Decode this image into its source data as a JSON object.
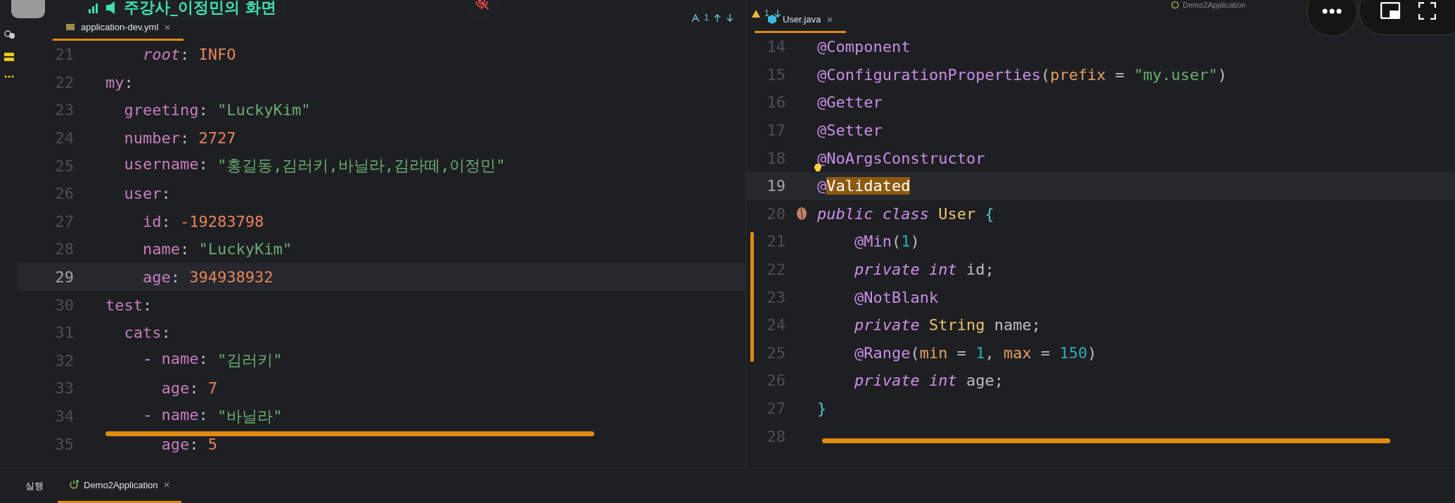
{
  "share_overlay": {
    "presenter_label": "주강사_이정민의 화면",
    "mic_muted": true
  },
  "run_config": {
    "label": "Demo2Application"
  },
  "editors": [
    {
      "tab": {
        "label": "application-dev.yml",
        "selected": true
      },
      "inspection": "1",
      "lines": [
        {
          "number": "21",
          "current": false,
          "tokens": [
            {
              "kind": "ikey",
              "text": "    root"
            },
            {
              "kind": "punct",
              "text": ": "
            },
            {
              "kind": "value",
              "text": "INFO"
            }
          ]
        },
        {
          "number": "22",
          "current": false,
          "tokens": [
            {
              "kind": "key",
              "text": "my"
            },
            {
              "kind": "punct",
              "text": ":"
            }
          ]
        },
        {
          "number": "23",
          "current": false,
          "tokens": [
            {
              "kind": "key",
              "text": "  greeting"
            },
            {
              "kind": "punct",
              "text": ": "
            },
            {
              "kind": "str",
              "text": "\"LuckyKim\""
            }
          ]
        },
        {
          "number": "24",
          "current": false,
          "tokens": [
            {
              "kind": "key",
              "text": "  number"
            },
            {
              "kind": "punct",
              "text": ": "
            },
            {
              "kind": "value",
              "text": "2727"
            }
          ]
        },
        {
          "number": "25",
          "current": false,
          "tokens": [
            {
              "kind": "key",
              "text": "  username"
            },
            {
              "kind": "punct",
              "text": ": "
            },
            {
              "kind": "str",
              "text": "\"홍길동,김러키,바닐라,김라떼,이정민\""
            }
          ]
        },
        {
          "number": "26",
          "current": false,
          "tokens": [
            {
              "kind": "key",
              "text": "  user"
            },
            {
              "kind": "punct",
              "text": ":"
            }
          ]
        },
        {
          "number": "27",
          "current": false,
          "tokens": [
            {
              "kind": "key",
              "text": "    id"
            },
            {
              "kind": "punct",
              "text": ": "
            },
            {
              "kind": "value",
              "text": "-19283798"
            }
          ]
        },
        {
          "number": "28",
          "current": false,
          "tokens": [
            {
              "kind": "key",
              "text": "    name"
            },
            {
              "kind": "punct",
              "text": ": "
            },
            {
              "kind": "str",
              "text": "\"LuckyKim\""
            }
          ]
        },
        {
          "number": "29",
          "current": true,
          "tokens": [
            {
              "kind": "key",
              "text": "    age"
            },
            {
              "kind": "punct",
              "text": ": "
            },
            {
              "kind": "value",
              "text": "394938932"
            }
          ]
        },
        {
          "number": "30",
          "current": false,
          "tokens": [
            {
              "kind": "key",
              "text": "test"
            },
            {
              "kind": "punct",
              "text": ":"
            }
          ]
        },
        {
          "number": "31",
          "current": false,
          "tokens": [
            {
              "kind": "key",
              "text": "  cats"
            },
            {
              "kind": "punct",
              "text": ":"
            }
          ]
        },
        {
          "number": "32",
          "current": false,
          "tokens": [
            {
              "kind": "dash",
              "text": "    - "
            },
            {
              "kind": "key",
              "text": "name"
            },
            {
              "kind": "punct",
              "text": ": "
            },
            {
              "kind": "str",
              "text": "\"김러키\""
            }
          ]
        },
        {
          "number": "33",
          "current": false,
          "tokens": [
            {
              "kind": "key",
              "text": "      age"
            },
            {
              "kind": "punct",
              "text": ": "
            },
            {
              "kind": "value",
              "text": "7"
            }
          ]
        },
        {
          "number": "34",
          "current": false,
          "tokens": [
            {
              "kind": "dash",
              "text": "    - "
            },
            {
              "kind": "key",
              "text": "name"
            },
            {
              "kind": "punct",
              "text": ": "
            },
            {
              "kind": "str",
              "text": "\"바닐라\""
            }
          ]
        },
        {
          "number": "35",
          "current": false,
          "tokens": [
            {
              "kind": "key",
              "text": "      age"
            },
            {
              "kind": "punct",
              "text": ": "
            },
            {
              "kind": "value",
              "text": "5"
            }
          ]
        }
      ]
    },
    {
      "tab": {
        "label": "User.java",
        "selected": true
      },
      "inspection": "1",
      "lines": [
        {
          "number": "14",
          "current": false,
          "tokens": [
            {
              "kind": "anno",
              "text": "@Component"
            }
          ]
        },
        {
          "number": "15",
          "current": false,
          "tokens": [
            {
              "kind": "anno",
              "text": "@ConfigurationProperties"
            },
            {
              "kind": "punct",
              "text": "("
            },
            {
              "kind": "param",
              "text": "prefix"
            },
            {
              "kind": "punct",
              "text": " = "
            },
            {
              "kind": "str",
              "text": "\"my.user\""
            },
            {
              "kind": "punct",
              "text": ")"
            }
          ]
        },
        {
          "number": "16",
          "current": false,
          "tokens": [
            {
              "kind": "anno",
              "text": "@Getter"
            }
          ]
        },
        {
          "number": "17",
          "current": false,
          "tokens": [
            {
              "kind": "anno",
              "text": "@Setter"
            }
          ]
        },
        {
          "number": "18",
          "current": false,
          "hint_icon": true,
          "tokens": [
            {
              "kind": "anno",
              "text": "@NoArgsConstructor"
            }
          ]
        },
        {
          "number": "19",
          "current": true,
          "tokens": [
            {
              "kind": "anno",
              "text": "@"
            },
            {
              "kind": "match",
              "text": "Validated"
            }
          ]
        },
        {
          "number": "20",
          "current": false,
          "bean_icon": true,
          "tokens": [
            {
              "kind": "kw",
              "text": "public class "
            },
            {
              "kind": "type",
              "text": "User"
            },
            {
              "kind": "brace",
              "text": " {"
            }
          ]
        },
        {
          "number": "21",
          "current": false,
          "tokens": [
            {
              "kind": "anno",
              "text": "    @Min"
            },
            {
              "kind": "punct",
              "text": "("
            },
            {
              "kind": "num",
              "text": "1"
            },
            {
              "kind": "punct",
              "text": ")"
            }
          ]
        },
        {
          "number": "22",
          "current": false,
          "tokens": [
            {
              "kind": "kw",
              "text": "    private int "
            },
            {
              "kind": "punct",
              "text": "id;"
            }
          ]
        },
        {
          "number": "23",
          "current": false,
          "tokens": [
            {
              "kind": "anno",
              "text": "    @NotBlank"
            }
          ]
        },
        {
          "number": "24",
          "current": false,
          "tokens": [
            {
              "kind": "kw",
              "text": "    private "
            },
            {
              "kind": "type",
              "text": "String"
            },
            {
              "kind": "punct",
              "text": " name;"
            }
          ]
        },
        {
          "number": "25",
          "current": false,
          "tokens": [
            {
              "kind": "anno",
              "text": "    @Range"
            },
            {
              "kind": "punct",
              "text": "("
            },
            {
              "kind": "param",
              "text": "min"
            },
            {
              "kind": "punct",
              "text": " = "
            },
            {
              "kind": "num",
              "text": "1"
            },
            {
              "kind": "punct",
              "text": ", "
            },
            {
              "kind": "param",
              "text": "max"
            },
            {
              "kind": "punct",
              "text": " = "
            },
            {
              "kind": "num",
              "text": "150"
            },
            {
              "kind": "punct",
              "text": ")"
            }
          ]
        },
        {
          "number": "26",
          "current": false,
          "tokens": [
            {
              "kind": "kw",
              "text": "    private int "
            },
            {
              "kind": "punct",
              "text": "age;"
            }
          ]
        },
        {
          "number": "27",
          "current": false,
          "tokens": [
            {
              "kind": "brace",
              "text": "}"
            }
          ]
        },
        {
          "number": "28",
          "current": false
        }
      ]
    }
  ],
  "bottom_panel": {
    "title": "실행",
    "tabs": [
      {
        "label": "Demo2Application",
        "selected": true
      }
    ]
  }
}
